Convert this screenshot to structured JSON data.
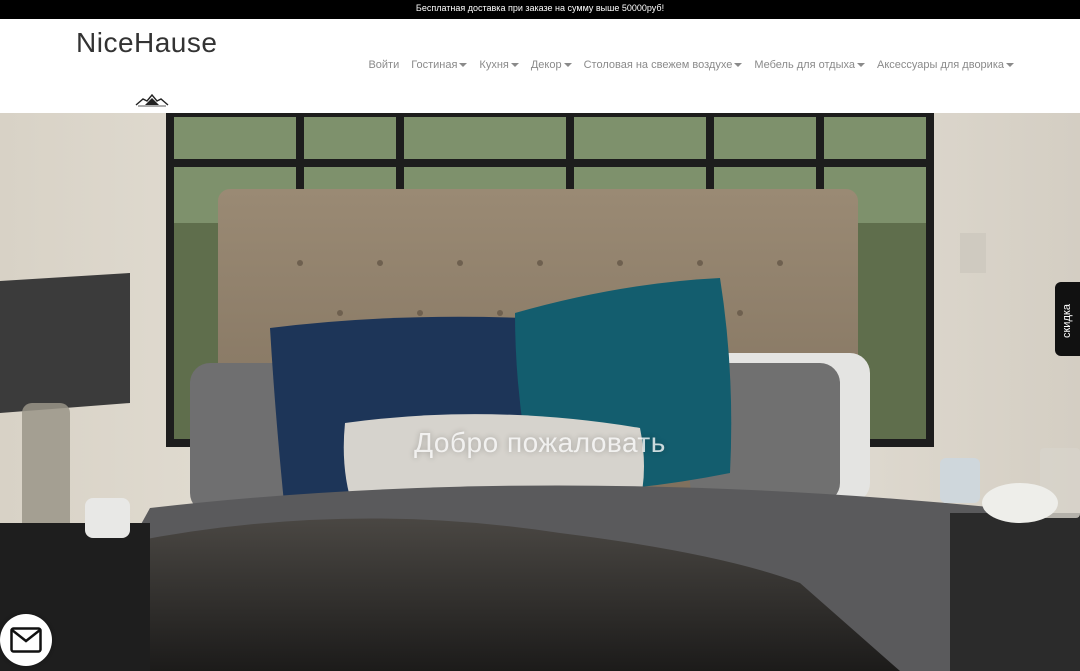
{
  "promo": {
    "text": "Бесплатная доставка при заказе на сумму выше 50000руб!"
  },
  "brand": {
    "name": "NiceHause"
  },
  "nav": {
    "items": [
      {
        "label": "Войти",
        "dropdown": false
      },
      {
        "label": "Гостиная",
        "dropdown": true
      },
      {
        "label": "Кухня",
        "dropdown": true
      },
      {
        "label": "Декор",
        "dropdown": true
      },
      {
        "label": "Столовая на свежем воздухе",
        "dropdown": true
      },
      {
        "label": "Мебель для отдыха",
        "dropdown": true
      },
      {
        "label": "Аксессуары для дворика",
        "dropdown": true
      }
    ]
  },
  "hero": {
    "title": "Добро пожаловать"
  },
  "side_tab": {
    "label": "скидка"
  },
  "icons": {
    "logo": "bird-logo-icon",
    "mail": "mail-icon",
    "caret": "caret-down-icon"
  },
  "colors": {
    "nav_text": "#8a8a8a",
    "promo_bg": "#000000",
    "brand_text": "#333333"
  }
}
